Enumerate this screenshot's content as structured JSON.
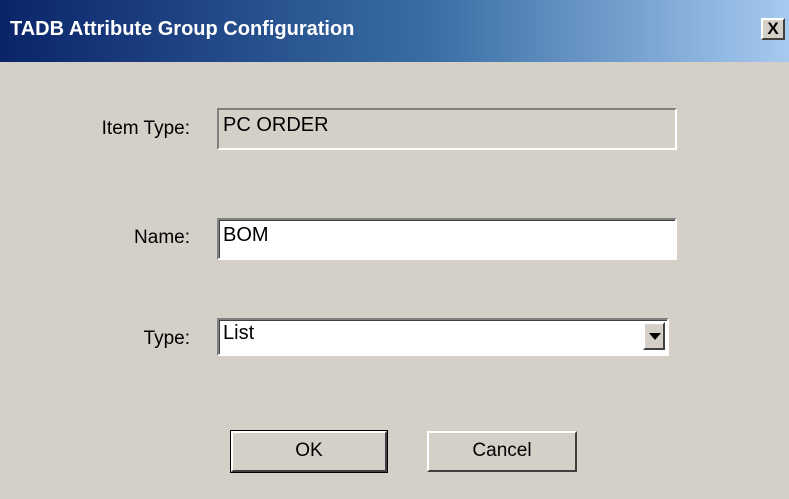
{
  "window": {
    "title": "TADB Attribute Group Configuration",
    "close_glyph": "X"
  },
  "form": {
    "item_type_label": "Item Type:",
    "item_type_value": "PC ORDER",
    "name_label": "Name:",
    "name_value": "BOM",
    "type_label": "Type:",
    "type_value": "List"
  },
  "buttons": {
    "ok_label": "OK",
    "cancel_label": "Cancel"
  },
  "icons": {
    "close": "close-icon",
    "dropdown": "chevron-down-icon"
  },
  "colors": {
    "titlebar_start": "#0a246a",
    "titlebar_end": "#a6caf0",
    "dialog_background": "#d4d0c8"
  }
}
